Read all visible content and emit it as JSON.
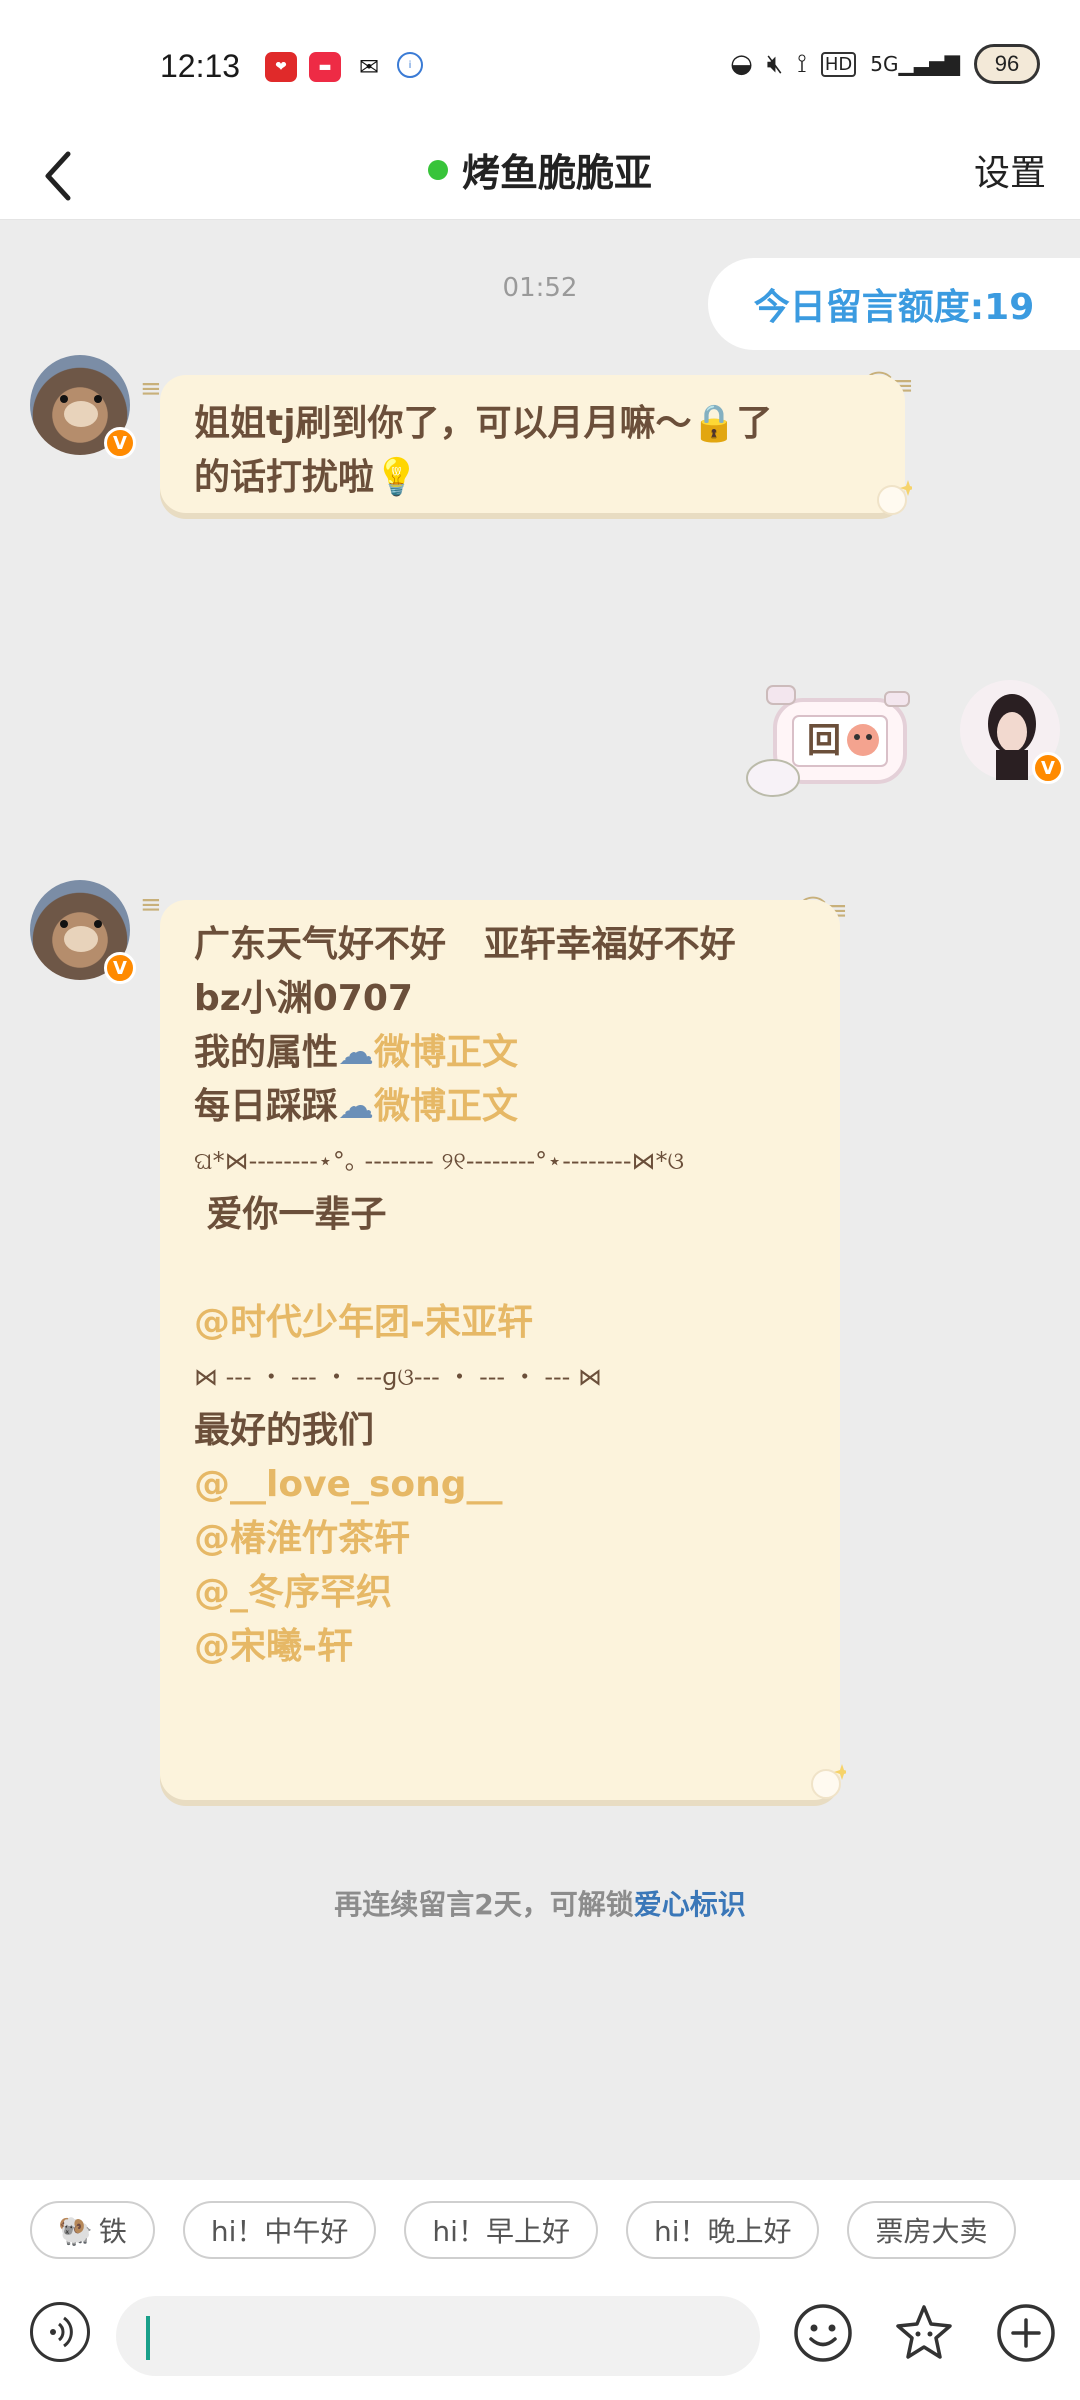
{
  "status_bar": {
    "time": "12:13",
    "signal_text": "5G",
    "battery": "96"
  },
  "header": {
    "title": "烤鱼脆脆亚",
    "settings": "设置"
  },
  "chat": {
    "timestamp": "01:52",
    "quota": "今日留言额度:19",
    "message1": {
      "line1": "姐姐tj刷到你了，可以月月嘛～🔒了",
      "line2": "的话打扰啦💡"
    },
    "sticker_text": "回",
    "message2": {
      "line1": "广东天气好不好   亚轩幸福好不好",
      "line2": "bz小渊0707",
      "line3_prefix": "我的属性",
      "line3_link": "微博正文",
      "line4_prefix": "每日踩踩",
      "line4_link": "微博正文",
      "line5": "ଘ*⋈--------⋆°｡ --------  ୨୧--------°⋆--------⋈*ଓ",
      "line6": " 爱你一辈子",
      "line7": "@时代少年团-宋亚轩",
      "line8": "⋈ --- ・ --- ・ ---ɡଓ--- ・ --- ・ --- ⋈",
      "line9": "最好的我们",
      "line10": "@__love_song__",
      "line11": "@椿淮竹茶轩",
      "line12": "@_冬序罕织",
      "line13": "@宋曦-轩"
    },
    "hint_prefix": "再连续留言2天，可解锁",
    "hint_link": "爱心标识"
  },
  "quick_replies": [
    "铁",
    "hi！中午好",
    "hi！早上好",
    "hi！晚上好",
    "票房大卖"
  ],
  "input": {
    "placeholder": ""
  },
  "colors": {
    "bubble": "#fcf3dc",
    "link": "#e6b866",
    "accent_blue": "#3b9be0",
    "online": "#38c43a"
  }
}
